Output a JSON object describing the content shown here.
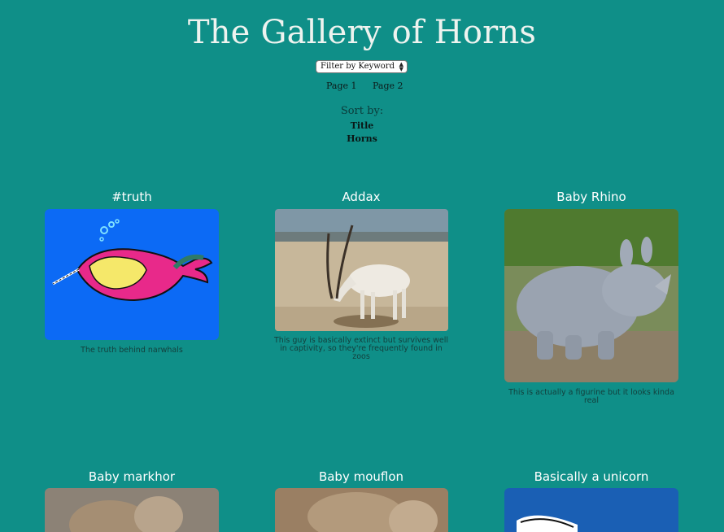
{
  "header": {
    "title": "The Gallery of Horns",
    "filter_label": "Filter by Keyword",
    "pages": [
      "Page 1",
      "Page 2"
    ]
  },
  "sort": {
    "label": "Sort by:",
    "options": [
      "Title",
      "Horns"
    ]
  },
  "cards": [
    {
      "title": "#truth",
      "description": "The truth behind narwhals",
      "image": "narwhal-illustration-icon"
    },
    {
      "title": "Addax",
      "description": "This guy is basically extinct but survives well in captivity, so they're frequently found in zoos",
      "image": "addax-photo"
    },
    {
      "title": "Baby Rhino",
      "description": "This is actually a figurine but it looks kinda real",
      "image": "rhino-figurine-photo"
    },
    {
      "title": "Baby markhor",
      "description": "",
      "image": "markhor-photo"
    },
    {
      "title": "Baby mouflon",
      "description": "",
      "image": "mouflon-photo"
    },
    {
      "title": "Basically a unicorn",
      "description": "",
      "image": "unicorn-illustration"
    }
  ],
  "colors": {
    "background": "#0f8f88",
    "title": "#eef3ef"
  }
}
